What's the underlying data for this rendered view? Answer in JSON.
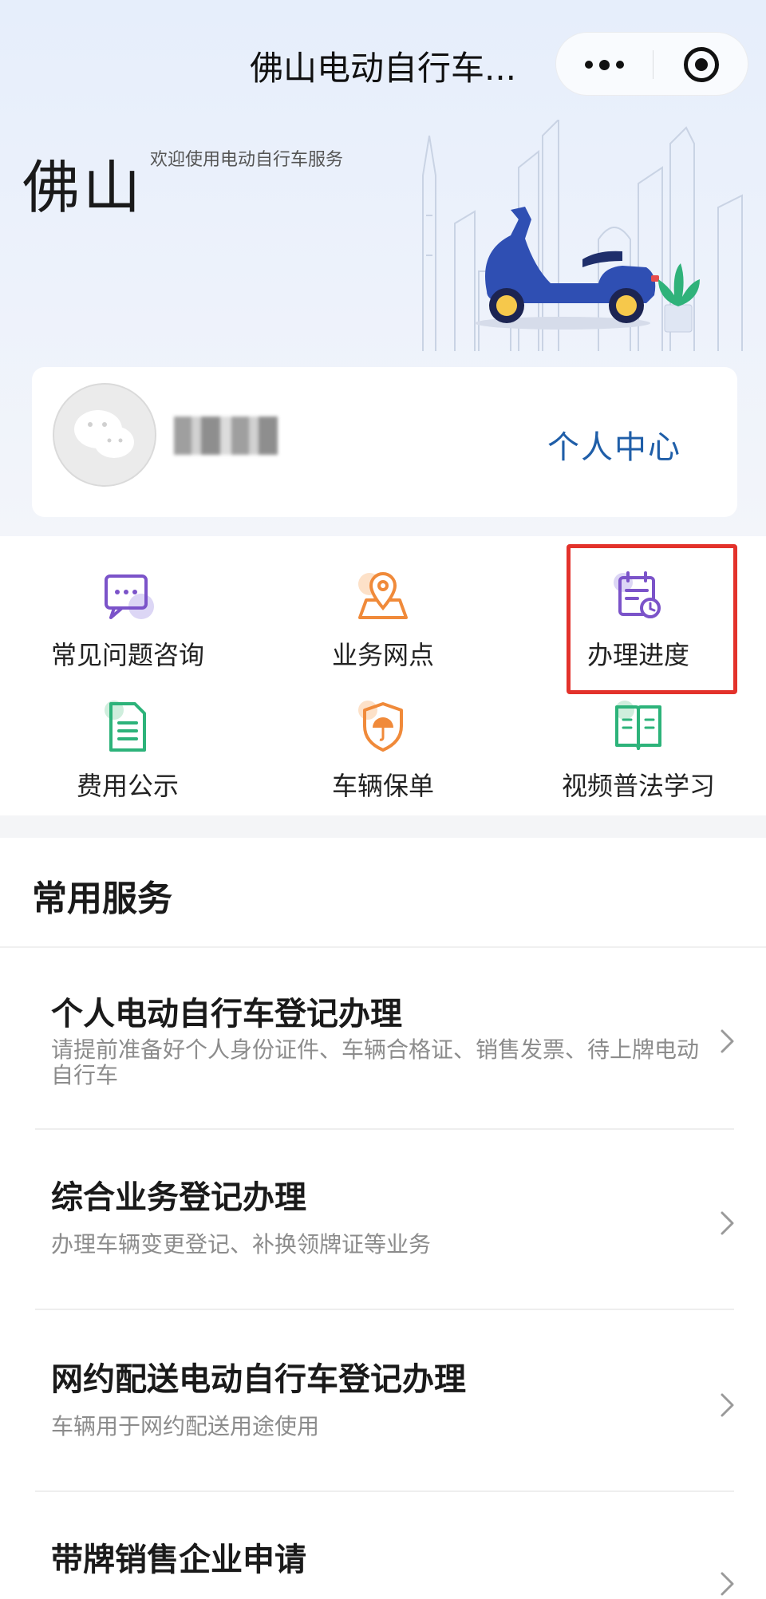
{
  "nav": {
    "title": "佛山电动自行车...",
    "more_icon": "more-dots-icon",
    "close_icon": "target-close-icon"
  },
  "hero": {
    "city": "佛山",
    "welcome": "欢迎使用电动自行车服务"
  },
  "user": {
    "avatar_icon": "wechat-avatar-icon",
    "name": "****",
    "personal_center": "个人中心"
  },
  "quick_links": [
    {
      "label": "常见问题咨询",
      "icon": "chat-bubble-icon",
      "color": "#7b53c9"
    },
    {
      "label": "业务网点",
      "icon": "map-pin-icon",
      "color": "#f08a3a"
    },
    {
      "label": "办理进度",
      "icon": "calendar-clock-icon",
      "color": "#7b53c9"
    },
    {
      "label": "费用公示",
      "icon": "document-icon",
      "color": "#2db37a"
    },
    {
      "label": "车辆保单",
      "icon": "shield-umbrella-icon",
      "color": "#f08a3a"
    },
    {
      "label": "视频普法学习",
      "icon": "open-book-icon",
      "color": "#2db37a"
    }
  ],
  "highlight_color": "#e3322b",
  "section": {
    "title": "常用服务"
  },
  "services": [
    {
      "title": "个人电动自行车登记办理",
      "desc": "请提前准备好个人身份证件、车辆合格证、销售发票、待上牌电动自行车"
    },
    {
      "title": "综合业务登记办理",
      "desc": "办理车辆变更登记、补换领牌证等业务"
    },
    {
      "title": "网约配送电动自行车登记办理",
      "desc": "车辆用于网约配送用途使用"
    },
    {
      "title": "带牌销售企业申请",
      "desc": ""
    }
  ],
  "colors": {
    "accent_blue": "#1f5ea8",
    "purple": "#7b53c9",
    "orange": "#f08a3a",
    "green": "#2db37a"
  }
}
